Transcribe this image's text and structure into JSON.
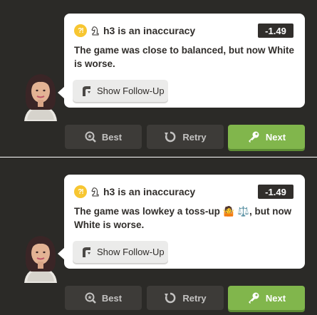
{
  "panels": [
    {
      "header": {
        "move": "h3 is an inaccuracy",
        "eval": "-1.49",
        "icon": "question-exclaim-icon",
        "piece_icon": "knight-icon"
      },
      "message": "The game was close to balanced, but now White is worse.",
      "follow_up_label": "Show Follow-Up",
      "buttons": {
        "best": "Best",
        "retry": "Retry",
        "next": "Next"
      }
    },
    {
      "header": {
        "move": "h3 is an inaccuracy",
        "eval": "-1.49",
        "icon": "question-exclaim-icon",
        "piece_icon": "knight-icon"
      },
      "message_part1": "The game was lowkey a toss-up ",
      "message_emoji": "🤷 ⚖️",
      "message_part2": ", but now White is worse.",
      "follow_up_label": "Show Follow-Up",
      "buttons": {
        "best": "Best",
        "retry": "Retry",
        "next": "Next"
      }
    }
  ],
  "colors": {
    "background": "#2b2a27",
    "accent_green": "#81b64c",
    "inaccuracy_yellow": "#f7c631",
    "eval_badge": "#312e2b"
  }
}
